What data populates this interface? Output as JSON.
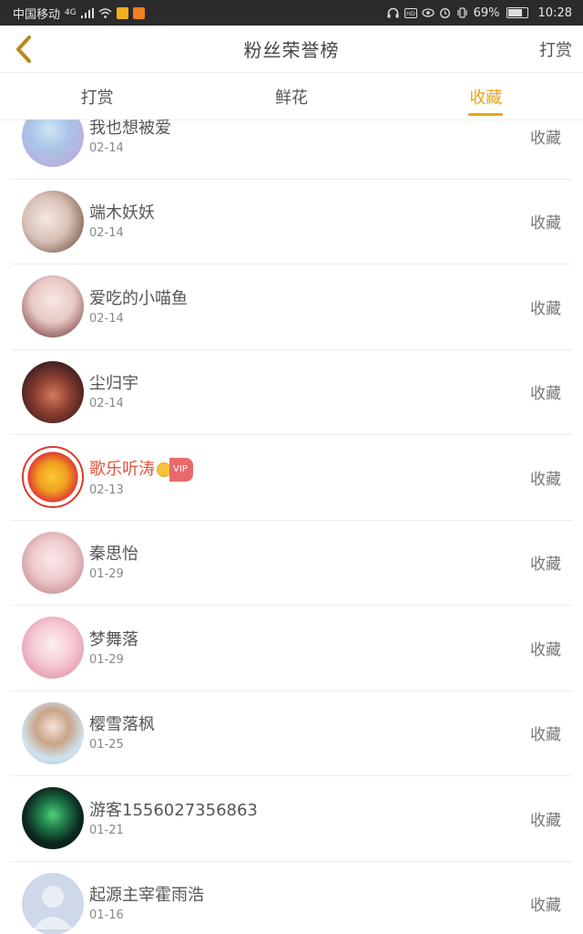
{
  "status_bar": {
    "carrier": "中国移动",
    "network": "4G",
    "battery": "69%",
    "battery_level": 0.69,
    "time": "10:28"
  },
  "header": {
    "title": "粉丝荣誉榜",
    "right_action": "打赏"
  },
  "tabs": [
    {
      "label": "打赏",
      "active": false
    },
    {
      "label": "鲜花",
      "active": false
    },
    {
      "label": "收藏",
      "active": true
    }
  ],
  "colors": {
    "accent": "#e8a615",
    "vip_name": "#e0543a"
  },
  "list": [
    {
      "name": "我也想被爱",
      "date": "02-14",
      "action": "收藏",
      "vip": false
    },
    {
      "name": "端木妖妖",
      "date": "02-14",
      "action": "收藏",
      "vip": false
    },
    {
      "name": "爱吃的小喵鱼",
      "date": "02-14",
      "action": "收藏",
      "vip": false
    },
    {
      "name": "尘归宇",
      "date": "02-14",
      "action": "收藏",
      "vip": false
    },
    {
      "name": "歌乐听涛",
      "date": "02-13",
      "action": "收藏",
      "vip": true,
      "vip_label": "VIP"
    },
    {
      "name": "秦思怡",
      "date": "01-29",
      "action": "收藏",
      "vip": false
    },
    {
      "name": "梦舞落",
      "date": "01-29",
      "action": "收藏",
      "vip": false
    },
    {
      "name": "樱雪落枫",
      "date": "01-25",
      "action": "收藏",
      "vip": false
    },
    {
      "name": "游客1556027356863",
      "date": "01-21",
      "action": "收藏",
      "vip": false
    },
    {
      "name": "起源主宰霍雨浩",
      "date": "01-16",
      "action": "收藏",
      "vip": false
    }
  ]
}
